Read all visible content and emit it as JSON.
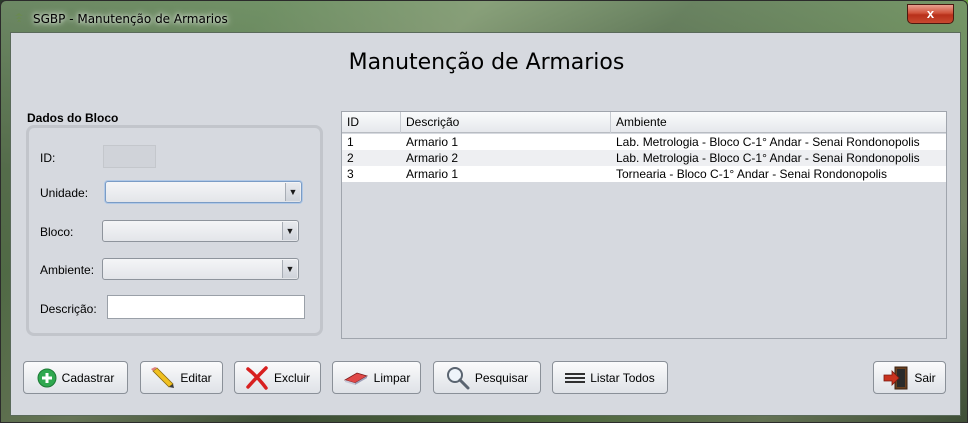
{
  "window": {
    "title": "SGBP - Manutenção de Armarios",
    "close_label": "x"
  },
  "page": {
    "title": "Manutenção de Armarios"
  },
  "form": {
    "group_title": "Dados do Bloco",
    "id_label": "ID:",
    "unidade_label": "Unidade:",
    "bloco_label": "Bloco:",
    "ambiente_label": "Ambiente:",
    "descricao_label": "Descrição:",
    "id_value": "",
    "unidade_value": "",
    "bloco_value": "",
    "ambiente_value": "",
    "descricao_value": ""
  },
  "table": {
    "columns": [
      "ID",
      "Descrição",
      "Ambiente"
    ],
    "rows": [
      [
        "1",
        "Armario 1",
        "Lab. Metrologia - Bloco C-1° Andar - Senai Rondonopolis"
      ],
      [
        "2",
        "Armario 2",
        "Lab. Metrologia - Bloco C-1° Andar - Senai Rondonopolis"
      ],
      [
        "3",
        "Armario 1",
        "Tornearia - Bloco C-1° Andar - Senai Rondonopolis"
      ]
    ]
  },
  "buttons": {
    "cadastrar": "Cadastrar",
    "editar": "Editar",
    "excluir": "Excluir",
    "limpar": "Limpar",
    "pesquisar": "Pesquisar",
    "listar_todos": "Listar Todos",
    "sair": "Sair"
  },
  "icons": {
    "cadastrar": "plus-circle-icon",
    "editar": "pencil-icon",
    "excluir": "x-mark-icon",
    "limpar": "eraser-icon",
    "pesquisar": "magnifier-icon",
    "listar_todos": "list-lines-icon",
    "sair": "exit-door-icon"
  },
  "colors": {
    "plus": "#2fa84f",
    "delete": "#d82020",
    "exit": "#c8321e"
  }
}
